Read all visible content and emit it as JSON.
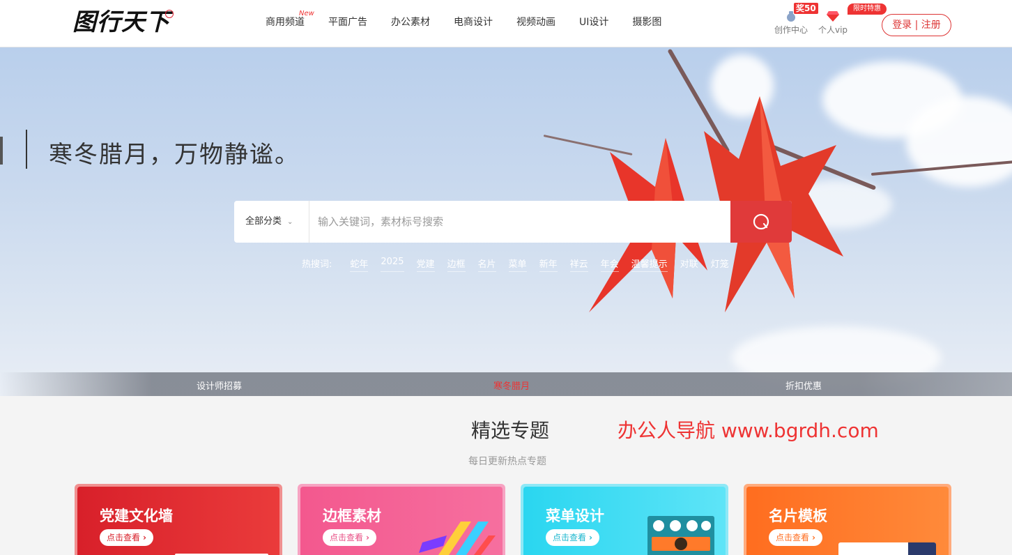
{
  "header": {
    "logo_text": "图行天下",
    "nav": [
      {
        "label": "商用频道",
        "badge": "New"
      },
      {
        "label": "平面广告"
      },
      {
        "label": "办公素材"
      },
      {
        "label": "电商设计"
      },
      {
        "label": "视频动画"
      },
      {
        "label": "UI设计"
      },
      {
        "label": "摄影图"
      }
    ],
    "create_center": {
      "label": "创作中心",
      "badge": "奖50"
    },
    "vip": {
      "label": "个人vip",
      "badge": "限时特惠"
    },
    "login_label": "登录 | 注册"
  },
  "banner": {
    "slogan": "寒冬腊月，万物静谧。",
    "search": {
      "category": "全部分类",
      "placeholder": "输入关键词，素材标号搜索"
    },
    "hot": {
      "label": "热搜词:",
      "words": [
        "蛇年",
        "2025",
        "党建",
        "边框",
        "名片",
        "菜单",
        "新年",
        "祥云",
        "年会",
        "温馨提示",
        "对联",
        "灯笼"
      ]
    },
    "strip": [
      "设计师招募",
      "寒冬腊月",
      "折扣优惠"
    ]
  },
  "section": {
    "title": "精选专题",
    "subtitle": "每日更新热点专题",
    "watermark": "办公人导航  www.bgrdh.com",
    "cards": [
      {
        "title": "党建文化墙",
        "button": "点击查看"
      },
      {
        "title": "边框素材",
        "button": "点击查看"
      },
      {
        "title": "菜单设计",
        "button": "点击查看"
      },
      {
        "title": "名片模板",
        "button": "点击查看"
      }
    ]
  },
  "colors": {
    "accent": "#e03a3a",
    "header_bg": "#ffffff",
    "page_bg": "#f4f4f4"
  }
}
